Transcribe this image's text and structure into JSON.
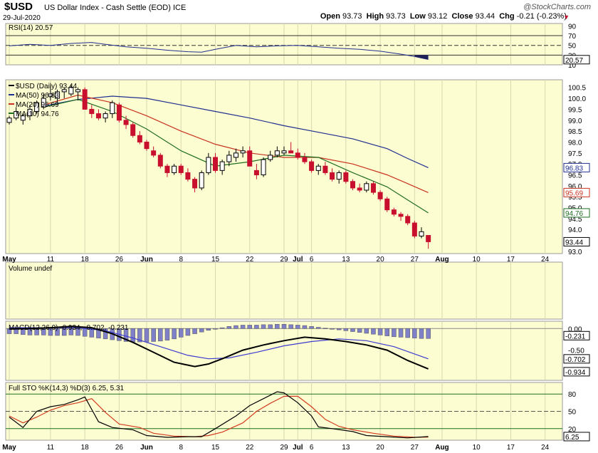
{
  "header": {
    "symbol": "$USD",
    "description": "US Dollar Index - Cash Settle (EOD) ICE",
    "date": "29-Jul-2020",
    "brand": "@StockCharts.com",
    "open_label": "Open",
    "open": "93.73",
    "high_label": "High",
    "high": "93.73",
    "low_label": "Low",
    "low": "93.12",
    "close_label": "Close",
    "close": "93.44",
    "chg_label": "Chg",
    "chg": "-0.21 (-0.23%)",
    "chg_arrow": "▼"
  },
  "colors": {
    "panel_bg": "#fdfdd2",
    "up": "#ffffff",
    "down": "#c8102e",
    "ma50": "#1f2f8f",
    "ma20": "#c8321e",
    "ma10": "#1f6e1f",
    "macd": "#000000",
    "signal": "#3b3bd0",
    "histogram": "#8080c8",
    "stok": "#000000",
    "stod": "#d23c1e",
    "rsi_fill": "#20205a"
  },
  "chart_data": {
    "type": "candlestick",
    "x_labels": [
      {
        "label": "May",
        "i": 0
      },
      {
        "label": "11",
        "i": 6
      },
      {
        "label": "18",
        "i": 11
      },
      {
        "label": "26",
        "i": 16
      },
      {
        "label": "Jun",
        "i": 20
      },
      {
        "label": "8",
        "i": 25
      },
      {
        "label": "15",
        "i": 30
      },
      {
        "label": "22",
        "i": 35
      },
      {
        "label": "29",
        "i": 40
      },
      {
        "label": "Jul",
        "i": 42
      },
      {
        "label": "6",
        "i": 44
      },
      {
        "label": "13",
        "i": 49
      },
      {
        "label": "20",
        "i": 54
      },
      {
        "label": "27",
        "i": 59
      },
      {
        "label": "Aug",
        "i": 63
      },
      {
        "label": "10",
        "i": 68
      },
      {
        "label": "17",
        "i": 73
      },
      {
        "label": "24",
        "i": 78
      }
    ],
    "total_slots": 81,
    "price": {
      "legend": [
        "$USD (Daily) 93.44",
        "MA(50) 96.83",
        "MA(20) 95.69",
        "MA(10) 94.76"
      ],
      "ylim": [
        92.9,
        100.85
      ],
      "y_ticks": [
        "100.5",
        "100.0",
        "99.5",
        "99.0",
        "98.5",
        "98.0",
        "97.5",
        "97.0",
        "96.5",
        "96.0",
        "95.5",
        "95.0",
        "94.5",
        "94.0",
        "93.5",
        "93.0"
      ],
      "last_labels": [
        "96.83",
        "95.69",
        "94.76",
        "93.44"
      ],
      "ohlc": [
        [
          98.9,
          99.2,
          98.8,
          99.1
        ],
        [
          99.1,
          99.6,
          99.0,
          99.4
        ],
        [
          99.0,
          99.3,
          98.8,
          99.2
        ],
        [
          99.2,
          99.7,
          99.0,
          99.5
        ],
        [
          99.4,
          99.9,
          99.3,
          99.8
        ],
        [
          99.6,
          100.2,
          99.5,
          100.0
        ],
        [
          100.1,
          100.6,
          99.9,
          100.2
        ],
        [
          100.0,
          100.4,
          99.8,
          100.3
        ],
        [
          100.3,
          100.5,
          100.0,
          100.4
        ],
        [
          100.2,
          100.6,
          100.1,
          100.5
        ],
        [
          100.3,
          100.5,
          99.9,
          100.4
        ],
        [
          100.4,
          100.5,
          99.8,
          99.5
        ],
        [
          99.5,
          99.7,
          99.1,
          99.3
        ],
        [
          99.3,
          99.5,
          99.0,
          99.1
        ],
        [
          99.1,
          99.4,
          98.9,
          99.3
        ],
        [
          99.3,
          99.9,
          99.1,
          99.8
        ],
        [
          99.7,
          99.8,
          98.9,
          99.0
        ],
        [
          99.0,
          99.2,
          98.6,
          98.8
        ],
        [
          98.8,
          98.9,
          98.2,
          98.3
        ],
        [
          98.3,
          98.5,
          97.9,
          98.0
        ],
        [
          98.0,
          98.1,
          97.6,
          97.7
        ],
        [
          97.6,
          97.8,
          97.3,
          97.4
        ],
        [
          97.4,
          97.5,
          96.8,
          96.9
        ],
        [
          96.9,
          97.0,
          96.4,
          96.6
        ],
        [
          96.6,
          97.0,
          96.5,
          96.9
        ],
        [
          96.9,
          97.0,
          96.5,
          96.6
        ],
        [
          96.6,
          96.8,
          96.2,
          96.3
        ],
        [
          96.3,
          96.4,
          95.7,
          95.9
        ],
        [
          95.9,
          96.7,
          95.8,
          96.6
        ],
        [
          96.6,
          97.5,
          96.5,
          97.3
        ],
        [
          97.3,
          97.5,
          96.6,
          96.7
        ],
        [
          96.7,
          97.2,
          96.5,
          97.1
        ],
        [
          97.1,
          97.6,
          96.9,
          97.4
        ],
        [
          97.3,
          97.7,
          97.1,
          97.5
        ],
        [
          97.5,
          97.8,
          97.3,
          97.6
        ],
        [
          97.6,
          97.8,
          96.9,
          96.9
        ],
        [
          96.7,
          97.0,
          96.3,
          96.5
        ],
        [
          96.5,
          97.3,
          96.4,
          97.2
        ],
        [
          97.2,
          97.6,
          97.1,
          97.4
        ],
        [
          97.4,
          97.8,
          97.3,
          97.6
        ],
        [
          97.5,
          97.8,
          97.4,
          97.6
        ],
        [
          97.6,
          98.0,
          97.5,
          97.5
        ],
        [
          97.5,
          97.7,
          97.2,
          97.3
        ],
        [
          97.3,
          97.5,
          97.0,
          97.1
        ],
        [
          97.1,
          97.2,
          96.6,
          96.7
        ],
        [
          96.7,
          97.0,
          96.5,
          96.9
        ],
        [
          96.9,
          97.1,
          96.5,
          96.6
        ],
        [
          96.6,
          96.8,
          96.2,
          96.3
        ],
        [
          96.3,
          96.7,
          96.1,
          96.6
        ],
        [
          96.6,
          96.7,
          96.1,
          96.2
        ],
        [
          96.2,
          96.3,
          95.8,
          95.9
        ],
        [
          95.9,
          96.1,
          95.7,
          95.8
        ],
        [
          95.8,
          96.2,
          95.7,
          96.1
        ],
        [
          96.1,
          96.2,
          95.6,
          95.7
        ],
        [
          95.7,
          95.8,
          95.3,
          95.4
        ],
        [
          95.4,
          95.5,
          94.8,
          94.9
        ],
        [
          94.9,
          95.0,
          94.6,
          94.7
        ],
        [
          94.7,
          94.8,
          94.4,
          94.6
        ],
        [
          94.6,
          94.7,
          94.2,
          94.3
        ],
        [
          94.3,
          94.4,
          93.6,
          93.7
        ],
        [
          93.7,
          94.1,
          93.6,
          93.9
        ],
        [
          93.73,
          93.73,
          93.12,
          93.44
        ]
      ],
      "ma50": [
        [
          5,
          99.65
        ],
        [
          10,
          99.95
        ],
        [
          15,
          100.1
        ],
        [
          20,
          100.0
        ],
        [
          25,
          99.7
        ],
        [
          30,
          99.4
        ],
        [
          35,
          99.1
        ],
        [
          40,
          98.75
        ],
        [
          45,
          98.45
        ],
        [
          50,
          98.15
        ],
        [
          55,
          97.7
        ],
        [
          58,
          97.25
        ],
        [
          61,
          96.83
        ]
      ],
      "ma20": [
        [
          5,
          99.7
        ],
        [
          10,
          100.15
        ],
        [
          15,
          99.8
        ],
        [
          20,
          99.2
        ],
        [
          25,
          98.5
        ],
        [
          30,
          97.9
        ],
        [
          35,
          97.5
        ],
        [
          40,
          97.3
        ],
        [
          45,
          97.3
        ],
        [
          50,
          97.0
        ],
        [
          55,
          96.5
        ],
        [
          58,
          96.1
        ],
        [
          61,
          95.69
        ]
      ],
      "ma10": [
        [
          5,
          99.6
        ],
        [
          10,
          99.95
        ],
        [
          15,
          99.4
        ],
        [
          20,
          98.6
        ],
        [
          25,
          97.6
        ],
        [
          30,
          96.9
        ],
        [
          35,
          97.1
        ],
        [
          40,
          97.4
        ],
        [
          45,
          97.3
        ],
        [
          50,
          96.6
        ],
        [
          55,
          95.95
        ],
        [
          58,
          95.35
        ],
        [
          61,
          94.76
        ]
      ]
    },
    "rsi": {
      "label": "RSI(14) 20.57",
      "ylim": [
        10,
        95
      ],
      "ticks": [
        "90",
        "70",
        "50",
        "30",
        "10"
      ],
      "last_label": "20.57",
      "levels": [
        70,
        50,
        30
      ],
      "values": [
        [
          0,
          49
        ],
        [
          3,
          52
        ],
        [
          6,
          50
        ],
        [
          9,
          54
        ],
        [
          12,
          56
        ],
        [
          14,
          52
        ],
        [
          17,
          47
        ],
        [
          20,
          44
        ],
        [
          23,
          40
        ],
        [
          26,
          37
        ],
        [
          28,
          36
        ],
        [
          30,
          42
        ],
        [
          33,
          50
        ],
        [
          36,
          47
        ],
        [
          39,
          49
        ],
        [
          42,
          50
        ],
        [
          45,
          47
        ],
        [
          48,
          44
        ],
        [
          51,
          42
        ],
        [
          54,
          38
        ],
        [
          57,
          32
        ],
        [
          59,
          27
        ],
        [
          61,
          21
        ]
      ]
    },
    "volume": {
      "label": "Volume undef"
    },
    "macd": {
      "label": "MACD(12,26,9) -0.934, -0.702, -0.231",
      "ylim": [
        -1.2,
        0.17
      ],
      "ticks": [
        "0.00",
        "-0.50"
      ],
      "last_labels": [
        "-0.231",
        "-0.702",
        "-0.934"
      ],
      "macd": [
        [
          0,
          -0.01
        ],
        [
          3,
          0.0
        ],
        [
          6,
          0.02
        ],
        [
          9,
          0.05
        ],
        [
          12,
          0.02
        ],
        [
          15,
          -0.12
        ],
        [
          18,
          -0.32
        ],
        [
          21,
          -0.55
        ],
        [
          24,
          -0.78
        ],
        [
          27,
          -0.88
        ],
        [
          29,
          -0.82
        ],
        [
          31,
          -0.7
        ],
        [
          34,
          -0.5
        ],
        [
          37,
          -0.38
        ],
        [
          40,
          -0.28
        ],
        [
          43,
          -0.2
        ],
        [
          46,
          -0.24
        ],
        [
          49,
          -0.3
        ],
        [
          52,
          -0.38
        ],
        [
          55,
          -0.5
        ],
        [
          58,
          -0.74
        ],
        [
          61,
          -0.934
        ]
      ],
      "signal": [
        [
          0,
          0.02
        ],
        [
          5,
          0.02
        ],
        [
          10,
          0.02
        ],
        [
          14,
          -0.05
        ],
        [
          18,
          -0.22
        ],
        [
          22,
          -0.42
        ],
        [
          26,
          -0.62
        ],
        [
          29,
          -0.7
        ],
        [
          32,
          -0.68
        ],
        [
          36,
          -0.55
        ],
        [
          40,
          -0.4
        ],
        [
          44,
          -0.3
        ],
        [
          48,
          -0.24
        ],
        [
          52,
          -0.28
        ],
        [
          56,
          -0.42
        ],
        [
          61,
          -0.702
        ]
      ],
      "hist": [
        [
          0,
          -0.12
        ],
        [
          1,
          -0.12
        ],
        [
          2,
          -0.14
        ],
        [
          3,
          -0.15
        ],
        [
          4,
          -0.15
        ],
        [
          5,
          -0.15
        ],
        [
          6,
          -0.16
        ],
        [
          7,
          -0.16
        ],
        [
          8,
          -0.16
        ],
        [
          9,
          -0.15
        ],
        [
          10,
          -0.16
        ],
        [
          11,
          -0.18
        ],
        [
          12,
          -0.2
        ],
        [
          13,
          -0.22
        ],
        [
          14,
          -0.24
        ],
        [
          15,
          -0.26
        ],
        [
          16,
          -0.28
        ],
        [
          17,
          -0.3
        ],
        [
          18,
          -0.31
        ],
        [
          19,
          -0.31
        ],
        [
          20,
          -0.31
        ],
        [
          21,
          -0.3
        ],
        [
          22,
          -0.29
        ],
        [
          23,
          -0.27
        ],
        [
          24,
          -0.24
        ],
        [
          25,
          -0.2
        ],
        [
          26,
          -0.16
        ],
        [
          27,
          -0.12
        ],
        [
          28,
          -0.08
        ],
        [
          29,
          -0.04
        ],
        [
          30,
          -0.01
        ],
        [
          31,
          0.02
        ],
        [
          32,
          0.05
        ],
        [
          33,
          0.07
        ],
        [
          34,
          0.08
        ],
        [
          35,
          0.08
        ],
        [
          36,
          0.08
        ],
        [
          37,
          0.09
        ],
        [
          38,
          0.09
        ],
        [
          39,
          0.1
        ],
        [
          40,
          0.1
        ],
        [
          41,
          0.09
        ],
        [
          42,
          0.08
        ],
        [
          43,
          0.07
        ],
        [
          44,
          0.05
        ],
        [
          45,
          0.03
        ],
        [
          46,
          0.01
        ],
        [
          47,
          -0.01
        ],
        [
          48,
          -0.03
        ],
        [
          49,
          -0.05
        ],
        [
          50,
          -0.07
        ],
        [
          51,
          -0.09
        ],
        [
          52,
          -0.11
        ],
        [
          53,
          -0.13
        ],
        [
          54,
          -0.15
        ],
        [
          55,
          -0.17
        ],
        [
          56,
          -0.19
        ],
        [
          57,
          -0.2
        ],
        [
          58,
          -0.21
        ],
        [
          59,
          -0.22
        ],
        [
          60,
          -0.23
        ],
        [
          61,
          -0.231
        ]
      ]
    },
    "sto": {
      "label": "Full STO %K(14,3) %D(3) 6.25, 5.31",
      "ylim": [
        0,
        100
      ],
      "ticks": [
        "80",
        "50",
        "20"
      ],
      "last_label": "6.25",
      "levels": [
        80,
        50,
        20
      ],
      "k": [
        [
          0,
          40
        ],
        [
          2,
          22
        ],
        [
          4,
          50
        ],
        [
          6,
          58
        ],
        [
          8,
          62
        ],
        [
          10,
          70
        ],
        [
          11,
          75
        ],
        [
          13,
          32
        ],
        [
          15,
          22
        ],
        [
          18,
          18
        ],
        [
          20,
          8
        ],
        [
          23,
          5
        ],
        [
          26,
          6
        ],
        [
          28,
          6
        ],
        [
          30,
          20
        ],
        [
          33,
          42
        ],
        [
          35,
          60
        ],
        [
          37,
          72
        ],
        [
          39,
          84
        ],
        [
          40,
          82
        ],
        [
          42,
          65
        ],
        [
          44,
          42
        ],
        [
          45,
          23
        ],
        [
          47,
          20
        ],
        [
          50,
          15
        ],
        [
          52,
          8
        ],
        [
          55,
          6
        ],
        [
          58,
          4
        ],
        [
          61,
          6.25
        ]
      ],
      "d": [
        [
          0,
          42
        ],
        [
          2,
          30
        ],
        [
          4,
          40
        ],
        [
          6,
          52
        ],
        [
          8,
          60
        ],
        [
          10,
          65
        ],
        [
          12,
          72
        ],
        [
          14,
          48
        ],
        [
          16,
          28
        ],
        [
          19,
          22
        ],
        [
          21,
          12
        ],
        [
          24,
          7
        ],
        [
          27,
          6
        ],
        [
          29,
          8
        ],
        [
          31,
          14
        ],
        [
          34,
          30
        ],
        [
          36,
          50
        ],
        [
          38,
          64
        ],
        [
          40,
          76
        ],
        [
          42,
          76
        ],
        [
          44,
          58
        ],
        [
          46,
          36
        ],
        [
          48,
          24
        ],
        [
          50,
          18
        ],
        [
          53,
          12
        ],
        [
          56,
          7
        ],
        [
          59,
          5
        ],
        [
          61,
          5.31
        ]
      ]
    }
  }
}
